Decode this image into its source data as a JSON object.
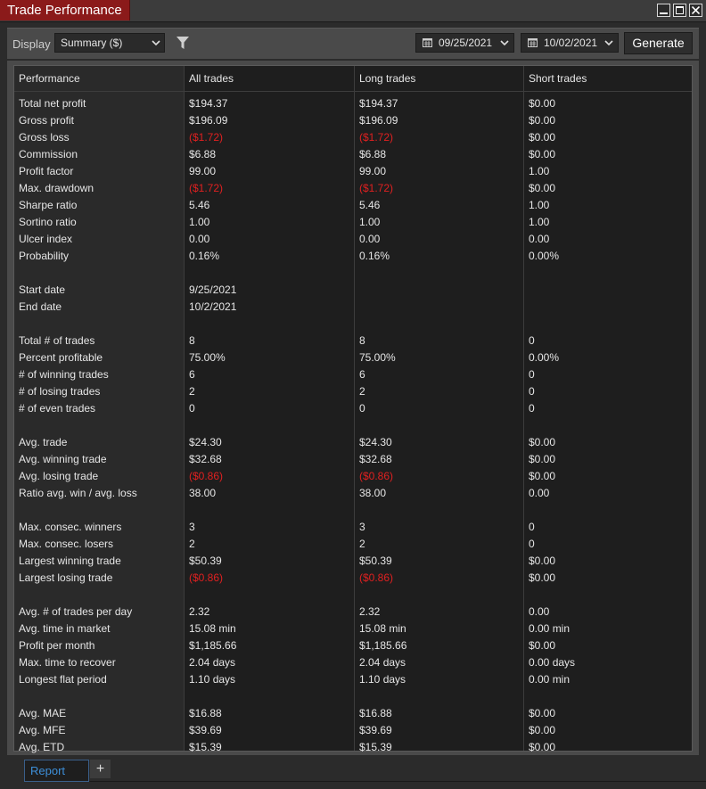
{
  "window": {
    "title": "Trade Performance"
  },
  "toolbar": {
    "display_label": "Display",
    "display_value": "Summary ($)",
    "start_date": "09/25/2021",
    "end_date": "10/02/2021",
    "generate_label": "Generate"
  },
  "table": {
    "headers": [
      "Performance",
      "All trades",
      "Long trades",
      "Short trades"
    ],
    "rows": [
      {
        "label": "Total net profit",
        "all": "$194.37",
        "long": "$194.37",
        "short": "$0.00"
      },
      {
        "label": "Gross profit",
        "all": "$196.09",
        "long": "$196.09",
        "short": "$0.00"
      },
      {
        "label": "Gross loss",
        "all": "($1.72)",
        "long": "($1.72)",
        "short": "$0.00"
      },
      {
        "label": "Commission",
        "all": "$6.88",
        "long": "$6.88",
        "short": "$0.00"
      },
      {
        "label": "Profit factor",
        "all": "99.00",
        "long": "99.00",
        "short": "1.00"
      },
      {
        "label": "Max. drawdown",
        "all": "($1.72)",
        "long": "($1.72)",
        "short": "$0.00"
      },
      {
        "label": "Sharpe ratio",
        "all": "5.46",
        "long": "5.46",
        "short": "1.00"
      },
      {
        "label": "Sortino ratio",
        "all": "1.00",
        "long": "1.00",
        "short": "1.00"
      },
      {
        "label": "Ulcer index",
        "all": "0.00",
        "long": "0.00",
        "short": "0.00"
      },
      {
        "label": "Probability",
        "all": "0.16%",
        "long": "0.16%",
        "short": "0.00%"
      },
      {
        "label": "",
        "all": "",
        "long": "",
        "short": ""
      },
      {
        "label": "Start date",
        "all": "9/25/2021",
        "long": "",
        "short": ""
      },
      {
        "label": "End date",
        "all": "10/2/2021",
        "long": "",
        "short": ""
      },
      {
        "label": "",
        "all": "",
        "long": "",
        "short": ""
      },
      {
        "label": "Total # of trades",
        "all": "8",
        "long": "8",
        "short": "0"
      },
      {
        "label": "Percent profitable",
        "all": "75.00%",
        "long": "75.00%",
        "short": "0.00%"
      },
      {
        "label": "# of winning trades",
        "all": "6",
        "long": "6",
        "short": "0"
      },
      {
        "label": "# of losing trades",
        "all": "2",
        "long": "2",
        "short": "0"
      },
      {
        "label": "# of even trades",
        "all": "0",
        "long": "0",
        "short": "0"
      },
      {
        "label": "",
        "all": "",
        "long": "",
        "short": ""
      },
      {
        "label": "Avg. trade",
        "all": "$24.30",
        "long": "$24.30",
        "short": "$0.00"
      },
      {
        "label": "Avg. winning trade",
        "all": "$32.68",
        "long": "$32.68",
        "short": "$0.00"
      },
      {
        "label": "Avg. losing trade",
        "all": "($0.86)",
        "long": "($0.86)",
        "short": "$0.00"
      },
      {
        "label": "Ratio avg. win / avg. loss",
        "all": "38.00",
        "long": "38.00",
        "short": "0.00"
      },
      {
        "label": "",
        "all": "",
        "long": "",
        "short": ""
      },
      {
        "label": "Max. consec. winners",
        "all": "3",
        "long": "3",
        "short": "0"
      },
      {
        "label": "Max. consec. losers",
        "all": "2",
        "long": "2",
        "short": "0"
      },
      {
        "label": "Largest winning trade",
        "all": "$50.39",
        "long": "$50.39",
        "short": "$0.00"
      },
      {
        "label": "Largest losing trade",
        "all": "($0.86)",
        "long": "($0.86)",
        "short": "$0.00"
      },
      {
        "label": "",
        "all": "",
        "long": "",
        "short": ""
      },
      {
        "label": "Avg. # of trades per day",
        "all": "2.32",
        "long": "2.32",
        "short": "0.00"
      },
      {
        "label": "Avg. time in market",
        "all": "15.08 min",
        "long": "15.08 min",
        "short": "0.00 min"
      },
      {
        "label": "Profit per month",
        "all": "$1,185.66",
        "long": "$1,185.66",
        "short": "$0.00"
      },
      {
        "label": "Max. time to recover",
        "all": "2.04 days",
        "long": "2.04 days",
        "short": "0.00 days"
      },
      {
        "label": "Longest flat period",
        "all": "1.10 days",
        "long": "1.10 days",
        "short": "0.00 min"
      },
      {
        "label": "",
        "all": "",
        "long": "",
        "short": ""
      },
      {
        "label": "Avg. MAE",
        "all": "$16.88",
        "long": "$16.88",
        "short": "$0.00"
      },
      {
        "label": "Avg. MFE",
        "all": "$39.69",
        "long": "$39.69",
        "short": "$0.00"
      },
      {
        "label": "Avg. ETD",
        "all": "$15.39",
        "long": "$15.39",
        "short": "$0.00"
      }
    ]
  },
  "tabs": {
    "report_label": "Report",
    "add_label": "+"
  },
  "colors": {
    "title_accent": "#8b1a1a",
    "negative": "#e02020",
    "tab_active": "#3d8fd9"
  }
}
